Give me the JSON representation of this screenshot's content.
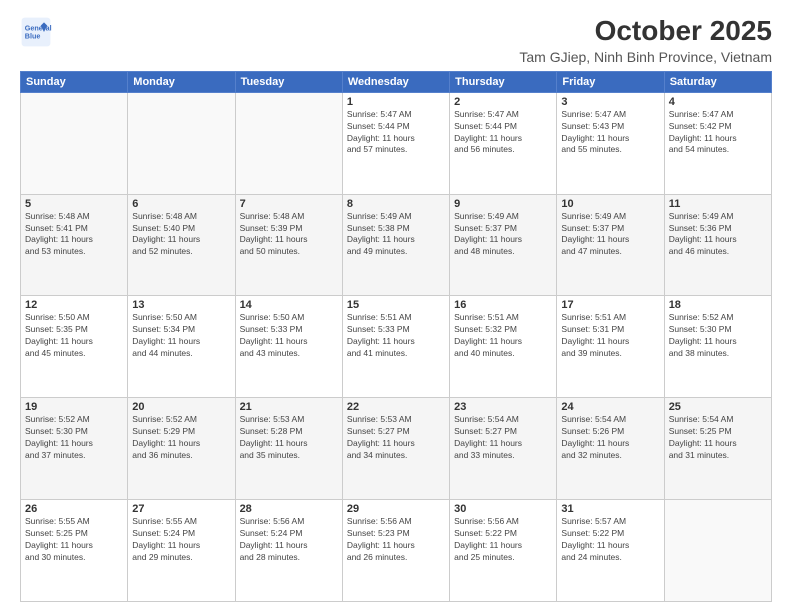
{
  "logo": {
    "line1": "General",
    "line2": "Blue"
  },
  "title": "October 2025",
  "subtitle": "Tam GJiep, Ninh Binh Province, Vietnam",
  "weekdays": [
    "Sunday",
    "Monday",
    "Tuesday",
    "Wednesday",
    "Thursday",
    "Friday",
    "Saturday"
  ],
  "weeks": [
    [
      {
        "day": "",
        "info": ""
      },
      {
        "day": "",
        "info": ""
      },
      {
        "day": "",
        "info": ""
      },
      {
        "day": "1",
        "info": "Sunrise: 5:47 AM\nSunset: 5:44 PM\nDaylight: 11 hours\nand 57 minutes."
      },
      {
        "day": "2",
        "info": "Sunrise: 5:47 AM\nSunset: 5:44 PM\nDaylight: 11 hours\nand 56 minutes."
      },
      {
        "day": "3",
        "info": "Sunrise: 5:47 AM\nSunset: 5:43 PM\nDaylight: 11 hours\nand 55 minutes."
      },
      {
        "day": "4",
        "info": "Sunrise: 5:47 AM\nSunset: 5:42 PM\nDaylight: 11 hours\nand 54 minutes."
      }
    ],
    [
      {
        "day": "5",
        "info": "Sunrise: 5:48 AM\nSunset: 5:41 PM\nDaylight: 11 hours\nand 53 minutes."
      },
      {
        "day": "6",
        "info": "Sunrise: 5:48 AM\nSunset: 5:40 PM\nDaylight: 11 hours\nand 52 minutes."
      },
      {
        "day": "7",
        "info": "Sunrise: 5:48 AM\nSunset: 5:39 PM\nDaylight: 11 hours\nand 50 minutes."
      },
      {
        "day": "8",
        "info": "Sunrise: 5:49 AM\nSunset: 5:38 PM\nDaylight: 11 hours\nand 49 minutes."
      },
      {
        "day": "9",
        "info": "Sunrise: 5:49 AM\nSunset: 5:37 PM\nDaylight: 11 hours\nand 48 minutes."
      },
      {
        "day": "10",
        "info": "Sunrise: 5:49 AM\nSunset: 5:37 PM\nDaylight: 11 hours\nand 47 minutes."
      },
      {
        "day": "11",
        "info": "Sunrise: 5:49 AM\nSunset: 5:36 PM\nDaylight: 11 hours\nand 46 minutes."
      }
    ],
    [
      {
        "day": "12",
        "info": "Sunrise: 5:50 AM\nSunset: 5:35 PM\nDaylight: 11 hours\nand 45 minutes."
      },
      {
        "day": "13",
        "info": "Sunrise: 5:50 AM\nSunset: 5:34 PM\nDaylight: 11 hours\nand 44 minutes."
      },
      {
        "day": "14",
        "info": "Sunrise: 5:50 AM\nSunset: 5:33 PM\nDaylight: 11 hours\nand 43 minutes."
      },
      {
        "day": "15",
        "info": "Sunrise: 5:51 AM\nSunset: 5:33 PM\nDaylight: 11 hours\nand 41 minutes."
      },
      {
        "day": "16",
        "info": "Sunrise: 5:51 AM\nSunset: 5:32 PM\nDaylight: 11 hours\nand 40 minutes."
      },
      {
        "day": "17",
        "info": "Sunrise: 5:51 AM\nSunset: 5:31 PM\nDaylight: 11 hours\nand 39 minutes."
      },
      {
        "day": "18",
        "info": "Sunrise: 5:52 AM\nSunset: 5:30 PM\nDaylight: 11 hours\nand 38 minutes."
      }
    ],
    [
      {
        "day": "19",
        "info": "Sunrise: 5:52 AM\nSunset: 5:30 PM\nDaylight: 11 hours\nand 37 minutes."
      },
      {
        "day": "20",
        "info": "Sunrise: 5:52 AM\nSunset: 5:29 PM\nDaylight: 11 hours\nand 36 minutes."
      },
      {
        "day": "21",
        "info": "Sunrise: 5:53 AM\nSunset: 5:28 PM\nDaylight: 11 hours\nand 35 minutes."
      },
      {
        "day": "22",
        "info": "Sunrise: 5:53 AM\nSunset: 5:27 PM\nDaylight: 11 hours\nand 34 minutes."
      },
      {
        "day": "23",
        "info": "Sunrise: 5:54 AM\nSunset: 5:27 PM\nDaylight: 11 hours\nand 33 minutes."
      },
      {
        "day": "24",
        "info": "Sunrise: 5:54 AM\nSunset: 5:26 PM\nDaylight: 11 hours\nand 32 minutes."
      },
      {
        "day": "25",
        "info": "Sunrise: 5:54 AM\nSunset: 5:25 PM\nDaylight: 11 hours\nand 31 minutes."
      }
    ],
    [
      {
        "day": "26",
        "info": "Sunrise: 5:55 AM\nSunset: 5:25 PM\nDaylight: 11 hours\nand 30 minutes."
      },
      {
        "day": "27",
        "info": "Sunrise: 5:55 AM\nSunset: 5:24 PM\nDaylight: 11 hours\nand 29 minutes."
      },
      {
        "day": "28",
        "info": "Sunrise: 5:56 AM\nSunset: 5:24 PM\nDaylight: 11 hours\nand 28 minutes."
      },
      {
        "day": "29",
        "info": "Sunrise: 5:56 AM\nSunset: 5:23 PM\nDaylight: 11 hours\nand 26 minutes."
      },
      {
        "day": "30",
        "info": "Sunrise: 5:56 AM\nSunset: 5:22 PM\nDaylight: 11 hours\nand 25 minutes."
      },
      {
        "day": "31",
        "info": "Sunrise: 5:57 AM\nSunset: 5:22 PM\nDaylight: 11 hours\nand 24 minutes."
      },
      {
        "day": "",
        "info": ""
      }
    ]
  ]
}
